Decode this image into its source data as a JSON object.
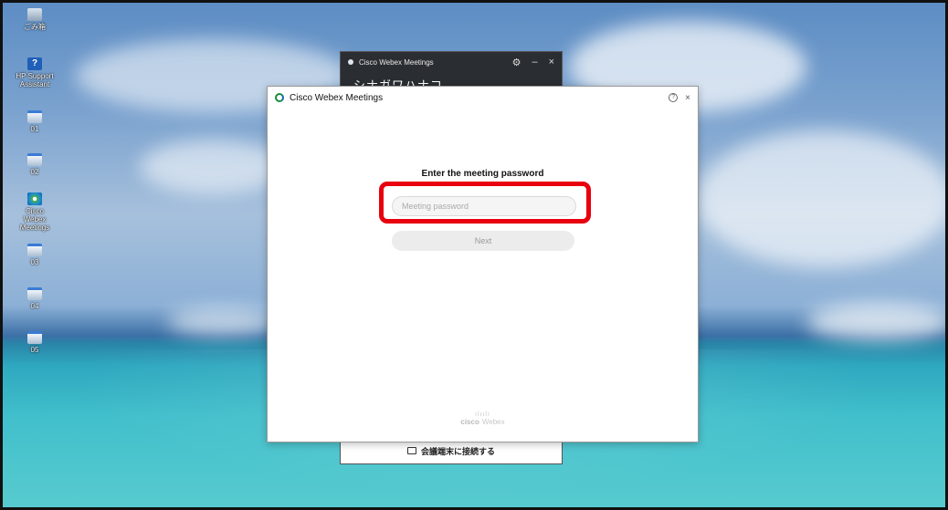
{
  "desktop": {
    "icons": [
      {
        "label": "ごみ箱",
        "icon": "recycle-bin-icon"
      },
      {
        "label": "HP Support Assistant",
        "icon": "help-icon"
      },
      {
        "label": "01",
        "icon": "file-icon"
      },
      {
        "label": "02",
        "icon": "file-icon"
      },
      {
        "label": "Cisco Webex Meetings",
        "icon": "webex-icon"
      },
      {
        "label": "03",
        "icon": "file-icon"
      },
      {
        "label": "04",
        "icon": "file-icon"
      },
      {
        "label": "05",
        "icon": "file-icon"
      }
    ]
  },
  "background_window": {
    "title": "Cisco Webex Meetings",
    "user_name": "シナガワハナコ",
    "connect_device_label": "会議端末に接続する",
    "controls": {
      "settings": "⚙",
      "minimize": "–",
      "close": "×"
    }
  },
  "dialog": {
    "title": "Cisco Webex Meetings",
    "help_glyph": "?",
    "close_glyph": "×",
    "prompt": "Enter the meeting password",
    "password_placeholder": "Meeting password",
    "password_value": "",
    "next_label": "Next",
    "brand_bars": "ılıılı",
    "brand_cisco": "cisco",
    "brand_webex": "Webex"
  },
  "colors": {
    "highlight": "#e8000e",
    "webex_green": "#1a8b3b",
    "webex_blue": "#1268b3"
  }
}
